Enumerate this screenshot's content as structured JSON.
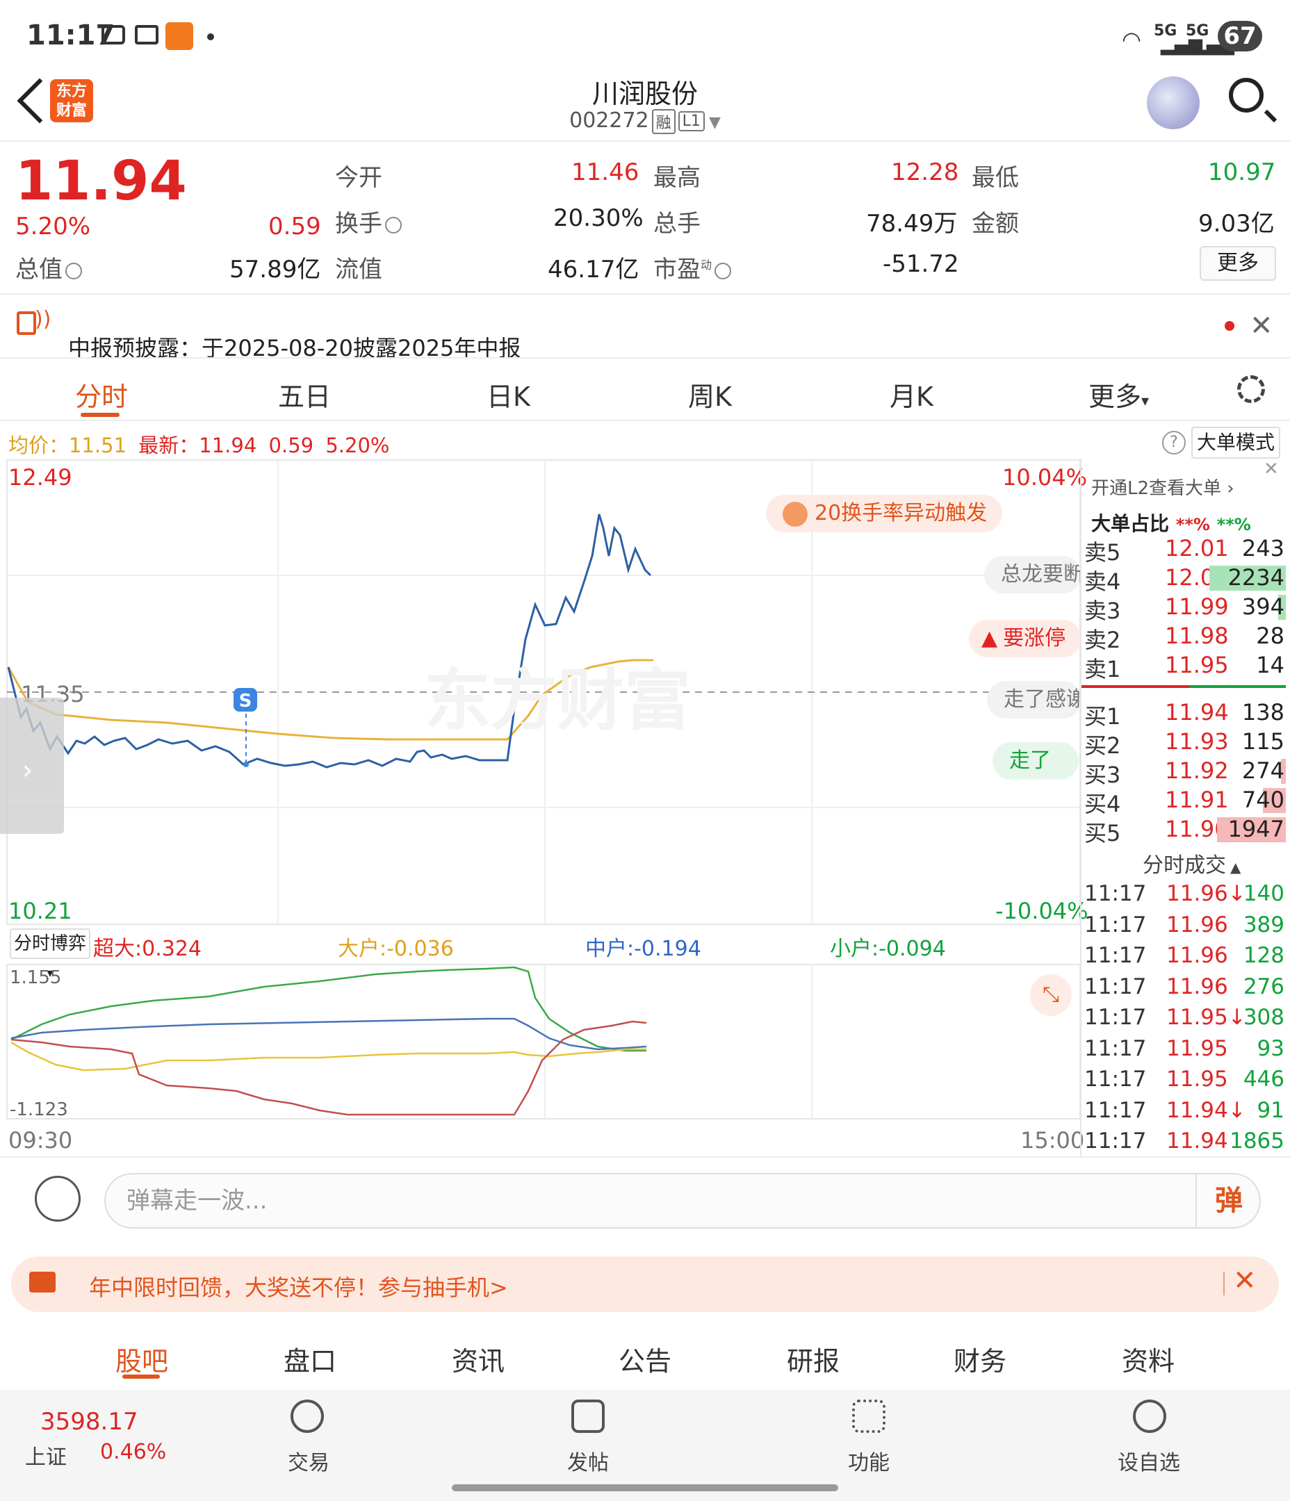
{
  "status": {
    "time": "11:17",
    "battery": "67",
    "signal1": "5G",
    "signal2": "5G"
  },
  "header": {
    "stock_name": "川润股份",
    "stock_code": "002272",
    "tag1": "融",
    "tag2": "L1",
    "logo_text": "东方财富"
  },
  "quote": {
    "price": "11.94",
    "change_pct": "5.20%",
    "change": "0.59",
    "total_value_label": "总值",
    "total_value": "57.89亿",
    "open_label": "今开",
    "open": "11.46",
    "high_label": "最高",
    "high": "12.28",
    "low_label": "最低",
    "low": "10.97",
    "turnover_label": "换手",
    "turnover": "20.30%",
    "volume_label": "总手",
    "volume": "78.49万",
    "amount_label": "金额",
    "amount": "9.03亿",
    "float_label": "流值",
    "float_value": "46.17亿",
    "pe_label": "市盈",
    "pe_sup": "动",
    "pe": "-51.72",
    "more": "更多"
  },
  "notice": {
    "text": "中报预披露：于2025-08-20披露2025年中报"
  },
  "tabs": [
    "分时",
    "五日",
    "日K",
    "周K",
    "月K",
    "更多"
  ],
  "legend": {
    "avg_label": "均价：",
    "avg": "11.51",
    "latest_label": "最新：",
    "latest": "11.94",
    "chg": "0.59",
    "pct": "5.20%",
    "mode": "大单模式"
  },
  "chart": {
    "y_max": "12.49",
    "y_min": "10.21",
    "pct_max": "10.04%",
    "pct_min": "-10.04%",
    "prev_close": "11.35",
    "x_start": "09:30",
    "x_end": "15:00",
    "s_marker": "S",
    "watermark": "东方财富"
  },
  "bubbles": {
    "b1": "20换手率异动触发",
    "b2": "总龙要断",
    "b3": "要涨停",
    "b4": "走了感谢",
    "b5": "走了"
  },
  "flow": {
    "title": "分时博弈",
    "super": "超大:0.324",
    "big": "大户:-0.036",
    "mid": "中户:-0.194",
    "small": "小户:-0.094",
    "y_max": "1.155",
    "y_min": "-1.123"
  },
  "orderbook": {
    "l2_link": "开通L2查看大单 ›",
    "ratio_label": "大单占比",
    "ratio_red": "**%",
    "ratio_green": "**%",
    "asks": [
      {
        "label": "卖5",
        "price": "12.01",
        "vol": "243",
        "bar": 0
      },
      {
        "label": "卖4",
        "price": "12.00",
        "vol": "2234",
        "bar": 1.0
      },
      {
        "label": "卖3",
        "price": "11.99",
        "vol": "394",
        "bar": 0.1
      },
      {
        "label": "卖2",
        "price": "11.98",
        "vol": "28",
        "bar": 0
      },
      {
        "label": "卖1",
        "price": "11.95",
        "vol": "14",
        "bar": 0
      }
    ],
    "bids": [
      {
        "label": "买1",
        "price": "11.94",
        "vol": "138",
        "bar": 0
      },
      {
        "label": "买2",
        "price": "11.93",
        "vol": "115",
        "bar": 0
      },
      {
        "label": "买3",
        "price": "11.92",
        "vol": "274",
        "bar": 0.06
      },
      {
        "label": "买4",
        "price": "11.91",
        "vol": "740",
        "bar": 0.3
      },
      {
        "label": "买5",
        "price": "11.90",
        "vol": "1947",
        "bar": 0.9
      }
    ]
  },
  "ticks": {
    "title": "分时成交",
    "rows": [
      {
        "time": "11:17",
        "price": "11.96↓",
        "vol": "140",
        "pc": "red",
        "vc": "green"
      },
      {
        "time": "11:17",
        "price": "11.96",
        "vol": "389",
        "pc": "red",
        "vc": "green"
      },
      {
        "time": "11:17",
        "price": "11.96",
        "vol": "128",
        "pc": "red",
        "vc": "green"
      },
      {
        "time": "11:17",
        "price": "11.96",
        "vol": "276",
        "pc": "red",
        "vc": "green"
      },
      {
        "time": "11:17",
        "price": "11.95↓",
        "vol": "308",
        "pc": "red",
        "vc": "green"
      },
      {
        "time": "11:17",
        "price": "11.95",
        "vol": "93",
        "pc": "red",
        "vc": "green"
      },
      {
        "time": "11:17",
        "price": "11.95",
        "vol": "446",
        "pc": "red",
        "vc": "green"
      },
      {
        "time": "11:17",
        "price": "11.94↓",
        "vol": "91",
        "pc": "red",
        "vc": "green"
      },
      {
        "time": "11:17",
        "price": "11.94",
        "vol": "1865",
        "pc": "red",
        "vc": "green"
      }
    ]
  },
  "danmu": {
    "placeholder": "弹幕走一波...",
    "button": "弹"
  },
  "promo": {
    "text": "年中限时回馈，大奖送不停！参与抽手机>"
  },
  "bottom_tabs": [
    "股吧",
    "盘口",
    "资讯",
    "公告",
    "研报",
    "财务",
    "资料"
  ],
  "index": {
    "value": "3598.17",
    "name": "上证",
    "pct": "0.46%"
  },
  "nav": [
    "交易",
    "发帖",
    "功能",
    "设自选"
  ]
}
